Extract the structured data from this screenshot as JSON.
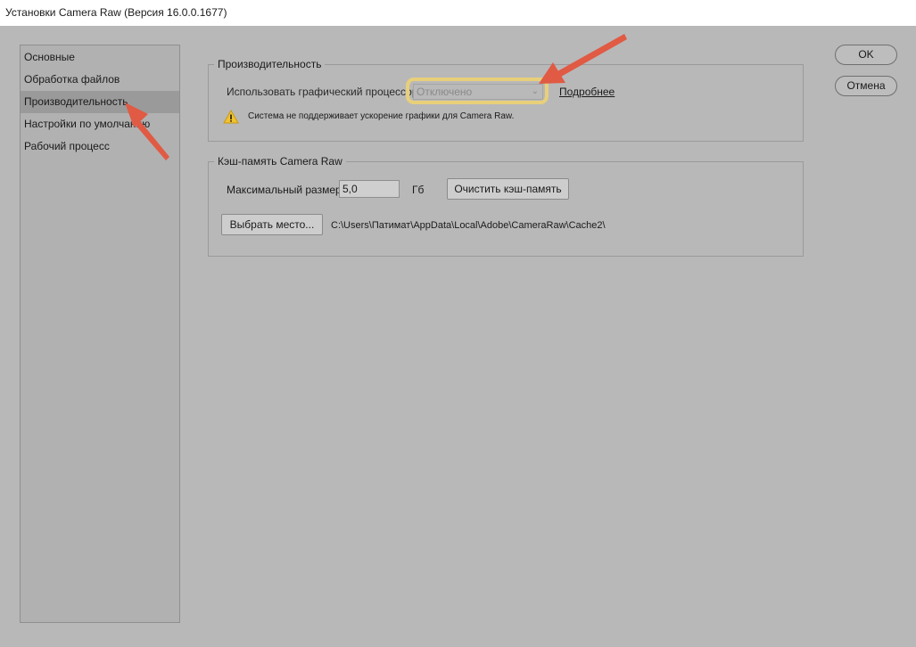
{
  "window": {
    "title": "Установки Camera Raw  (Версия 16.0.0.1677)"
  },
  "sidebar": {
    "items": [
      {
        "label": "Основные"
      },
      {
        "label": "Обработка файлов"
      },
      {
        "label": "Производительность"
      },
      {
        "label": "Настройки по умолчанию"
      },
      {
        "label": "Рабочий процесс"
      }
    ],
    "selected": "Производительность"
  },
  "performance": {
    "title": "Производительность",
    "gpu_label": "Использовать графический процессор:",
    "gpu_value": "Отключено",
    "more_link": "Подробнее",
    "warning": "Система не поддерживает ускорение графики для Camera Raw.",
    "warning_icon": "warning-triangle-icon"
  },
  "cache": {
    "title": "Кэш-память Camera Raw",
    "max_size_label": "Максимальный размер:",
    "max_size_value": "5,0",
    "unit": "Гб",
    "purge_button": "Очистить кэш-память",
    "choose_location_button": "Выбрать место...",
    "path": "C:\\Users\\Патимат\\AppData\\Local\\Adobe\\CameraRaw\\Cache2\\"
  },
  "buttons": {
    "ok": "OK",
    "cancel": "Отмена"
  },
  "colors": {
    "annotation_arrow": "#e05a44",
    "highlight": "#e8cf7a"
  }
}
